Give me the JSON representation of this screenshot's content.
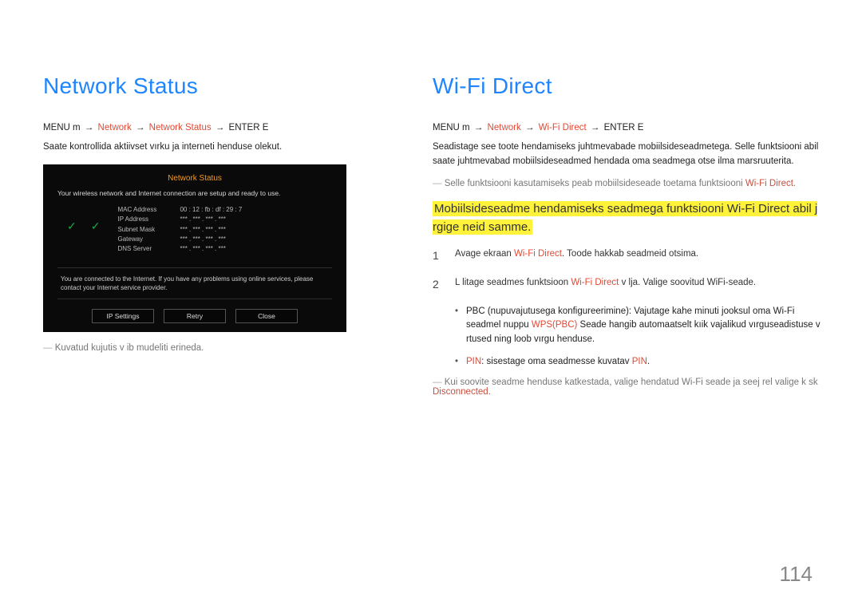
{
  "page_number": "114",
  "left": {
    "heading": "Network Status",
    "path_prefix": "MENU m",
    "path_sep": "→",
    "path_network": "Network",
    "path_item": "Network Status",
    "path_suffix": "ENTER E",
    "desc": "Saate kontrollida aktiivset vırku ja interneti henduse olekut.",
    "device": {
      "title": "Network Status",
      "status_line": "Your wireless network and Internet connection are setup and ready to use.",
      "rows": [
        {
          "k": "MAC Address",
          "v": "00 : 12 : fb : df : 29 : 7"
        },
        {
          "k": "IP Address",
          "v": "*** . *** . *** . ***"
        },
        {
          "k": "Subnet Mask",
          "v": "*** . *** . *** . ***"
        },
        {
          "k": "Gateway",
          "v": "*** . *** . *** . ***"
        },
        {
          "k": "DNS Server",
          "v": "*** . *** . *** . ***"
        }
      ],
      "connected_msg": "You are connected to the Internet. If you have any problems using online services, please contact your Internet service provider.",
      "buttons": {
        "ip": "IP Settings",
        "retry": "Retry",
        "close": "Close"
      }
    },
    "note": "Kuvatud kujutis v ib mudeliti erineda."
  },
  "right": {
    "heading": "Wi-Fi Direct",
    "path_prefix": "MENU m",
    "path_sep": "→",
    "path_network": "Network",
    "path_item": "Wi-Fi Direct",
    "path_suffix": "ENTER E",
    "desc1": "Seadistage see toote  hendamiseks juhtmevabade mobiilsideseadmetega. Selle funktsiooni abil saate juhtmevabad mobiilsideseadmed  hendada oma seadmega otse ilma marsruuterita.",
    "note1_pre": "Selle funktsiooni kasutamiseks peab mobiilsideseade toetama funktsiooni ",
    "note1_red": "Wi-Fi Direct",
    "note1_post": ".",
    "highlight": "Mobiilsideseadme  hendamiseks seadmega funktsiooni Wi-Fi Direct abil j rgige neid samme.",
    "steps": {
      "s1_num": "1",
      "s1_pre": "Avage ekraan ",
      "s1_red": "Wi-Fi Direct",
      "s1_post": ". Toode hakkab seadmeid otsima.",
      "s2_num": "2",
      "s2_pre": "L litage seadmes funktsioon ",
      "s2_red": "Wi-Fi Direct",
      "s2_post": " v lja. Valige soovitud WiFi-seade."
    },
    "sub": {
      "b1_pre": "PBC (nupuvajutusega konfigureerimine): Vajutage kahe minuti jooksul oma Wi-Fi seadmel nuppu ",
      "b1_red": "WPS(PBC)",
      "b1_post": " Seade hangib automaatselt kıik vajalikud vırguseadistuse v  rtused ning loob vırgu henduse.",
      "b2_red1": "PIN",
      "b2_mid": ": sisestage oma seadmesse kuvatav ",
      "b2_red2": "PIN",
      "b2_post": "."
    },
    "note2_pre": "Kui soovite seadme  henduse katkestada, valige  hendatud Wi-Fi seade ja seej rel valige k sk ",
    "note2_red": "Disconnected",
    "note2_post": "."
  }
}
